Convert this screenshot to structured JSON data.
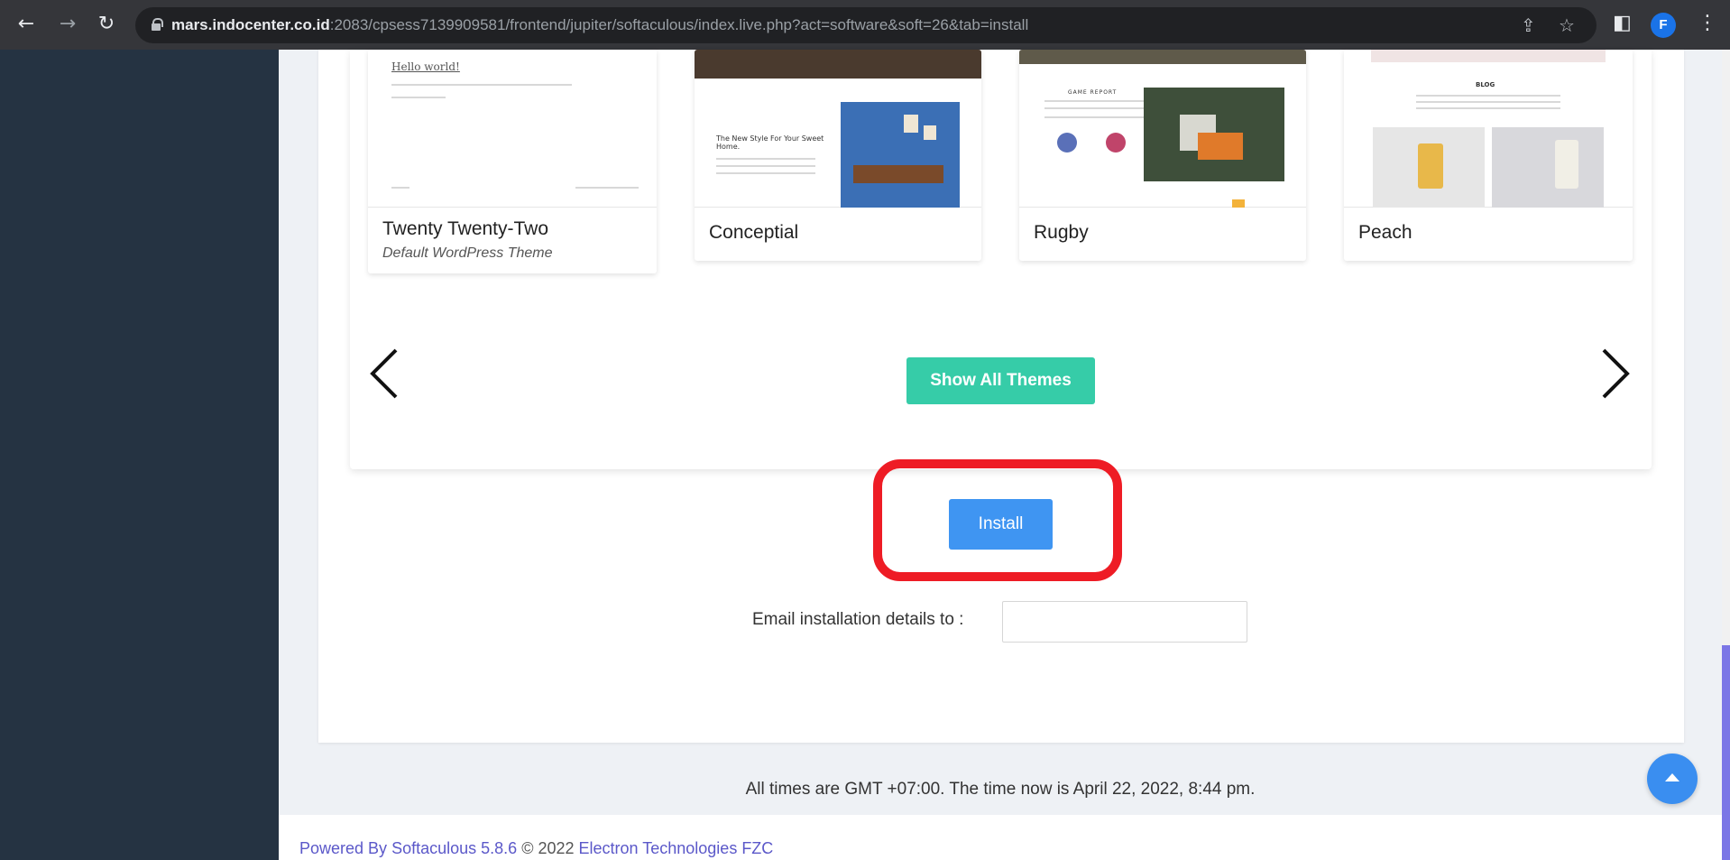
{
  "browser": {
    "url_host": "mars.indocenter.co.id",
    "url_rest": ":2083/cpsess7139909581/frontend/jupiter/softaculous/index.live.php?act=software&soft=26&tab=install",
    "profile_initial": "F"
  },
  "themes": [
    {
      "name": "Twenty Twenty-Two",
      "subtitle": "Default WordPress Theme",
      "preview_heading": "Hello world!"
    },
    {
      "name": "Conceptial",
      "subtitle": "",
      "preview_heading": "The New Style For Your Sweet Home."
    },
    {
      "name": "Rugby",
      "subtitle": "",
      "preview_heading": "GAME REPORT"
    },
    {
      "name": "Peach",
      "subtitle": "",
      "preview_heading": "BLOG"
    }
  ],
  "carousel": {
    "show_all_label": "Show All Themes"
  },
  "install": {
    "button_label": "Install",
    "email_label": "Email installation details to :",
    "email_value": ""
  },
  "time_info": "All times are GMT +07:00. The time now is April 22, 2022, 8:44 pm.",
  "footer": {
    "powered_prefix": "Powered By",
    "powered_link": "Softaculous 5.8.6",
    "copyright": "© 2022",
    "company_link": "Electron Technologies FZC"
  },
  "colors": {
    "accent_green": "#36cca8",
    "install_blue": "#3f95f2",
    "highlight_red": "#ee1c25",
    "sidebar": "#253342"
  }
}
